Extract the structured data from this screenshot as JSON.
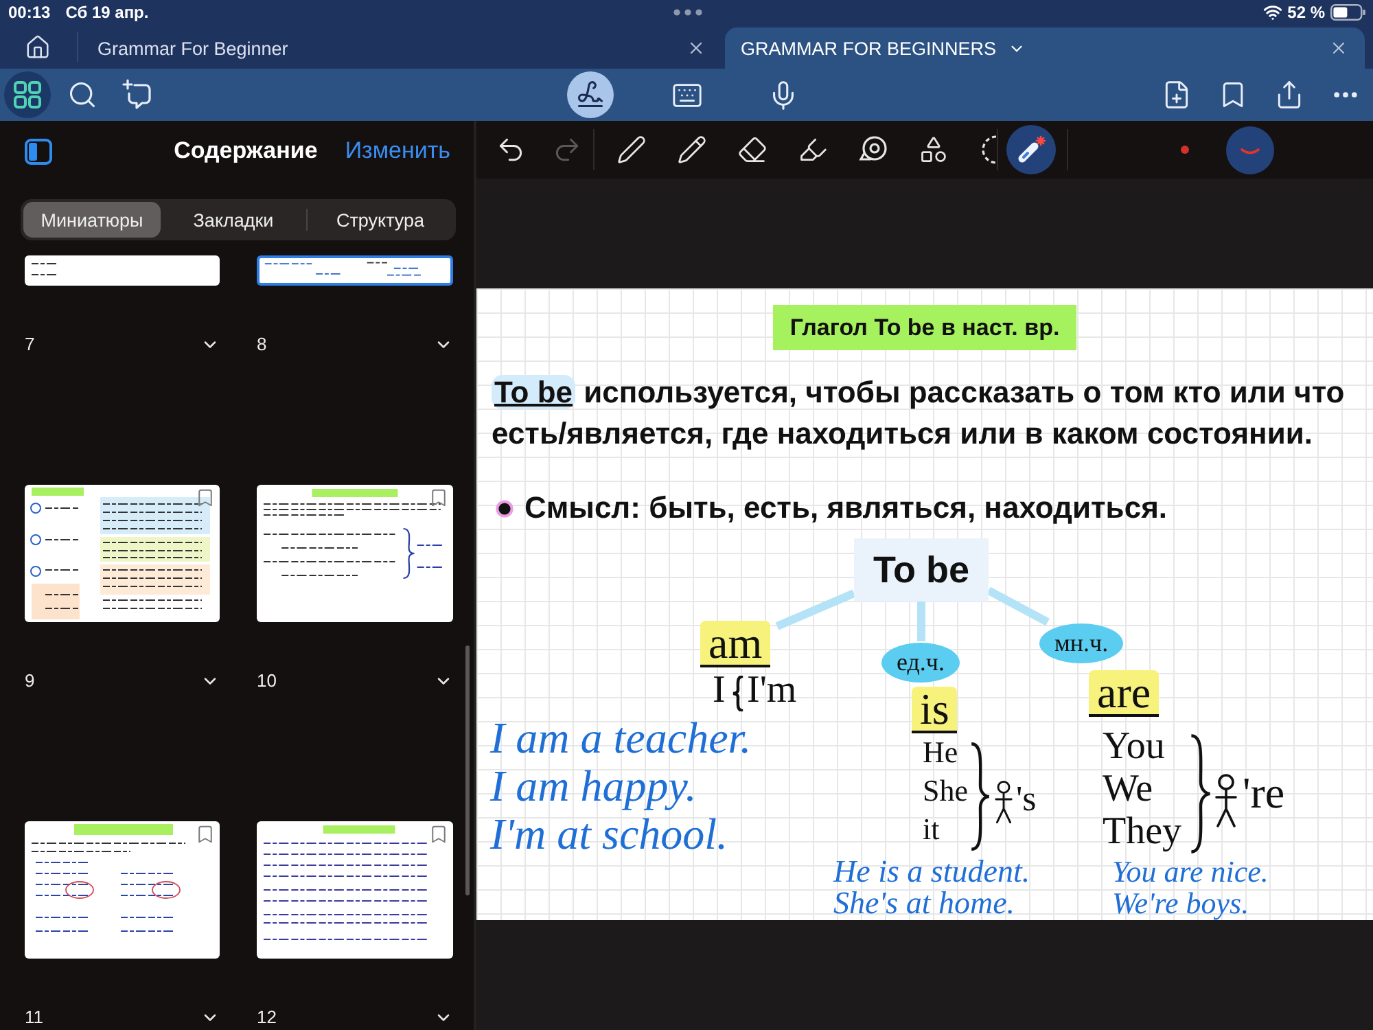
{
  "status_bar": {
    "time": "00:13",
    "date": "Сб 19 апр.",
    "battery": "52 %"
  },
  "tabs": [
    {
      "title": "Grammar For Beginner",
      "selected": false
    },
    {
      "title": "GRAMMAR FOR BEGINNERS",
      "selected": true
    }
  ],
  "toolbar": {
    "view_buttons": [
      {
        "selected": true
      },
      {
        "selected": false
      },
      {
        "selected": false
      }
    ],
    "input_modes": [
      {
        "selected": true
      },
      {
        "selected": false
      },
      {
        "selected": false
      }
    ]
  },
  "sidebar": {
    "title": "Содержание",
    "edit": "Изменить",
    "segments": [
      {
        "label": "Миниатюры",
        "selected": true
      },
      {
        "label": "Закладки",
        "selected": false
      },
      {
        "label": "Структура",
        "selected": false
      }
    ],
    "pages": [
      {
        "number": "7",
        "kind": "partial",
        "selected": false
      },
      {
        "number": "8",
        "kind": "partial",
        "selected": true
      },
      {
        "number": "9",
        "kind": "full",
        "selected": false
      },
      {
        "number": "10",
        "kind": "full",
        "selected": false
      },
      {
        "number": "11",
        "kind": "full",
        "selected": false
      },
      {
        "number": "12",
        "kind": "full",
        "selected": false
      }
    ]
  },
  "drawing_toolbar": {
    "history": [
      {
        "disabled": false
      },
      {
        "disabled": true
      }
    ],
    "tools": [
      {
        "selected": false
      },
      {
        "selected": false
      },
      {
        "selected": false
      },
      {
        "selected": false
      },
      {
        "selected": false
      },
      {
        "selected": false
      },
      {
        "selected": false
      },
      {
        "selected": true
      }
    ]
  },
  "note": {
    "title": "Глагол To be в наст. вр.",
    "intro": {
      "term": "To be",
      "text": "используется, чтобы рассказать о том кто или что есть/является, где находиться или в каком состоянии."
    },
    "bullet": "Смысл: быть, есть, являться, находиться.",
    "diagram": {
      "root": "To be",
      "branches": [
        {
          "kind": "single",
          "verb": "am",
          "pronouns": [
            "I"
          ],
          "contraction": "I'm",
          "examples": [
            "I am a teacher.",
            "I am happy.",
            "I'm at school."
          ]
        },
        {
          "kind": "group",
          "number": "ед.ч.",
          "verb": "is",
          "pronouns": [
            "He",
            "She",
            "it"
          ],
          "contraction": "'s",
          "examples": [
            "He is a student.",
            "She's at home."
          ]
        },
        {
          "kind": "group",
          "number": "мн.ч.",
          "verb": "are",
          "pronouns": [
            "You",
            "We",
            "They"
          ],
          "contraction": "'re",
          "examples": [
            "You are nice.",
            "We're boys."
          ]
        }
      ]
    }
  }
}
